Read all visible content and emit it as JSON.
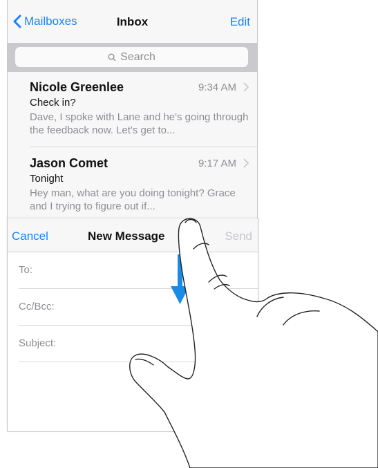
{
  "inbox": {
    "back_label": "Mailboxes",
    "title": "Inbox",
    "edit_label": "Edit",
    "search_placeholder": "Search",
    "messages": [
      {
        "sender": "Nicole Greenlee",
        "time": "9:34 AM",
        "subject": "Check in?",
        "preview": "Dave, I spoke with Lane and he's going through the feedback now. Let's get to..."
      },
      {
        "sender": "Jason Comet",
        "time": "9:17 AM",
        "subject": "Tonight",
        "preview": "Hey man, what are you doing tonight? Grace and I trying to figure out if..."
      }
    ]
  },
  "compose": {
    "cancel_label": "Cancel",
    "title": "New Message",
    "send_label": "Send",
    "fields": [
      {
        "label": "To:"
      },
      {
        "label": "Cc/Bcc:"
      },
      {
        "label": "Subject:"
      }
    ]
  },
  "colors": {
    "accent": "#1a82fb",
    "arrow": "#1a8be6",
    "muted": "#8e8e93",
    "disabled": "#c7c7cc"
  },
  "icons": [
    "chevron-left-icon",
    "search-icon",
    "chevron-right-icon",
    "down-arrow-icon",
    "hand-gesture-icon"
  ]
}
